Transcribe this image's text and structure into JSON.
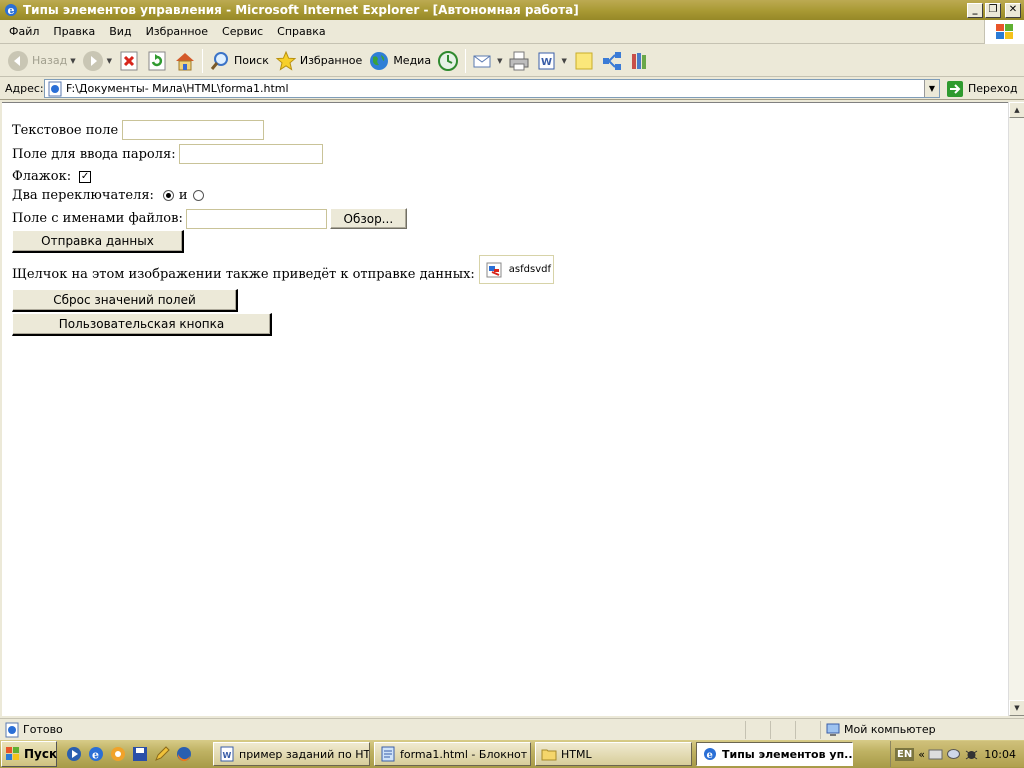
{
  "window": {
    "title": "Типы элементов управления - Microsoft Internet Explorer - [Автономная работа]",
    "minimize": "_",
    "maximize": "❐",
    "close": "✕"
  },
  "menu": [
    "Файл",
    "Правка",
    "Вид",
    "Избранное",
    "Сервис",
    "Справка"
  ],
  "toolbar": {
    "back": "Назад",
    "search": "Поиск",
    "favorites": "Избранное",
    "media": "Медиа"
  },
  "address": {
    "label": "Адрес:",
    "url": "F:\\Документы- Мила\\HTML\\forma1.html",
    "go": "Переход"
  },
  "form": {
    "text_label": "Текстовое поле",
    "text_value": "",
    "password_label": "Поле для ввода пароля:",
    "password_value": "",
    "checkbox_label": "Флажок:",
    "checkbox_checked": true,
    "checkbox_mark": "✓",
    "radio_label": "Два переключателя:",
    "radio_joiner": "и",
    "radio_selected": 0,
    "file_label": "Поле с именами файлов:",
    "file_value": "",
    "browse_button": "Обзор...",
    "submit_button": "Отправка данных",
    "image_text": "Щелчок на этом изображении также приведёт к отправке данных:",
    "image_alt": "asfdsvdf",
    "reset_button": "Сброс значений полей",
    "custom_button": "Пользовательская кнопка"
  },
  "status": {
    "text": "Готово",
    "zone": "Мой компьютер"
  },
  "taskbar": {
    "start": "Пуск",
    "tasks": [
      {
        "label": "пример заданий по HT...",
        "icon": "word-icon",
        "active": false
      },
      {
        "label": "forma1.html - Блокнот",
        "icon": "notepad-icon",
        "active": false
      },
      {
        "label": "HTML",
        "icon": "folder-icon",
        "active": false
      },
      {
        "label": "Типы элементов уп...",
        "icon": "ie-icon",
        "active": true
      }
    ],
    "lang": "EN",
    "clock": "10:04"
  },
  "colors": {
    "titlebar": "#a89933",
    "chrome": "#ece9d8",
    "taskbar": "#bfb263"
  }
}
